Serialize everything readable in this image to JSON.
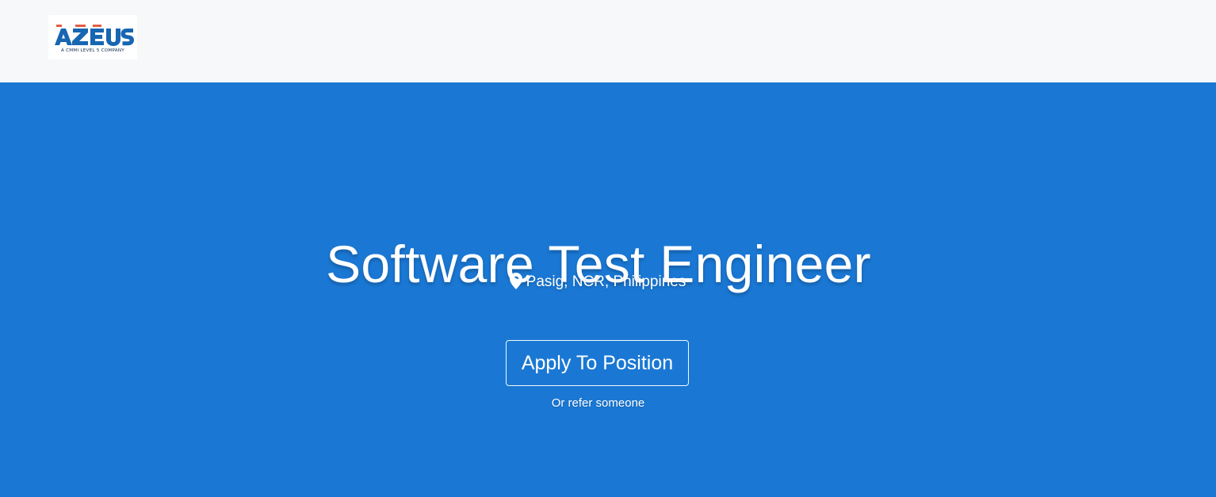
{
  "header": {
    "logo": {
      "brand_name": "AZEUS",
      "tagline": "A CMMI LEVEL 5 COMPANY",
      "primary_color": "#1766b2",
      "accent_color": "#e35d3f"
    }
  },
  "hero": {
    "title": "Software Test Engineer",
    "location": "Pasig, NCR, Philippines",
    "location_icon": "map-pin-icon",
    "apply_label": "Apply To Position",
    "refer_label": "Or refer someone",
    "background_color": "#1a78d4"
  }
}
